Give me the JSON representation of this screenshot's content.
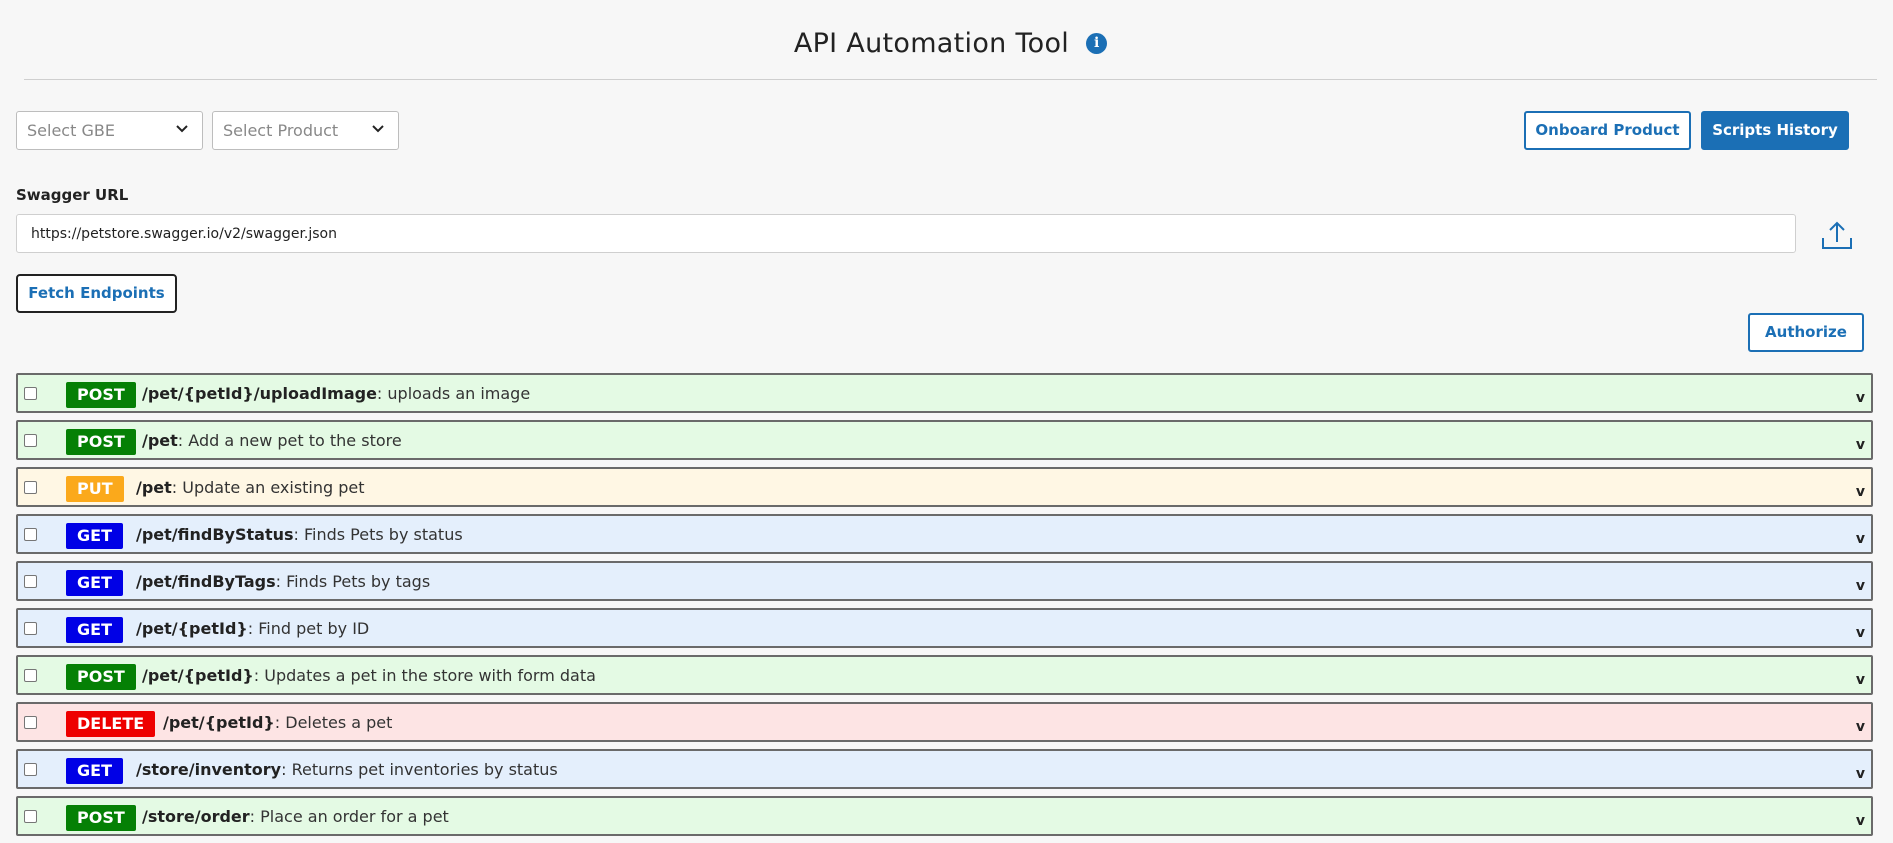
{
  "header": {
    "title": "API Automation Tool",
    "info_icon_glyph": "i"
  },
  "filters": {
    "gbe_placeholder": "Select GBE",
    "product_placeholder": "Select Product"
  },
  "actions": {
    "onboard_label": "Onboard Product",
    "history_label": "Scripts History",
    "fetch_label": "Fetch Endpoints",
    "authorize_label": "Authorize"
  },
  "swagger": {
    "label": "Swagger URL",
    "value": "https://petstore.swagger.io/v2/swagger.json"
  },
  "colors": {
    "primary": "#1b6fb5",
    "POST": "#058005",
    "PUT": "#fba91b",
    "GET": "#0000e6",
    "DELETE": "#ee0000",
    "POST_bg": "#e4fae4",
    "PUT_bg": "#fff7e4",
    "GET_bg": "#e4effc",
    "DELETE_bg": "#fde4e4"
  },
  "endpoints": [
    {
      "method": "POST",
      "path": "/pet/{petId}/uploadImage",
      "desc": ": uploads an image",
      "caret": "v"
    },
    {
      "method": "POST",
      "path": "/pet",
      "desc": ": Add a new pet to the store",
      "caret": "v"
    },
    {
      "method": "PUT",
      "path": "/pet",
      "desc": ": Update an existing pet",
      "caret": "v"
    },
    {
      "method": "GET",
      "path": "/pet/findByStatus",
      "desc": ": Finds Pets by status",
      "caret": "v"
    },
    {
      "method": "GET",
      "path": "/pet/findByTags",
      "desc": ": Finds Pets by tags",
      "caret": "v"
    },
    {
      "method": "GET",
      "path": "/pet/{petId}",
      "desc": ": Find pet by ID",
      "caret": "v"
    },
    {
      "method": "POST",
      "path": "/pet/{petId}",
      "desc": ": Updates a pet in the store with form data",
      "caret": "v"
    },
    {
      "method": "DELETE",
      "path": "/pet/{petId}",
      "desc": ": Deletes a pet",
      "caret": "v"
    },
    {
      "method": "GET",
      "path": "/store/inventory",
      "desc": ": Returns pet inventories by status",
      "caret": "v"
    },
    {
      "method": "POST",
      "path": "/store/order",
      "desc": ": Place an order for a pet",
      "caret": "v"
    }
  ]
}
